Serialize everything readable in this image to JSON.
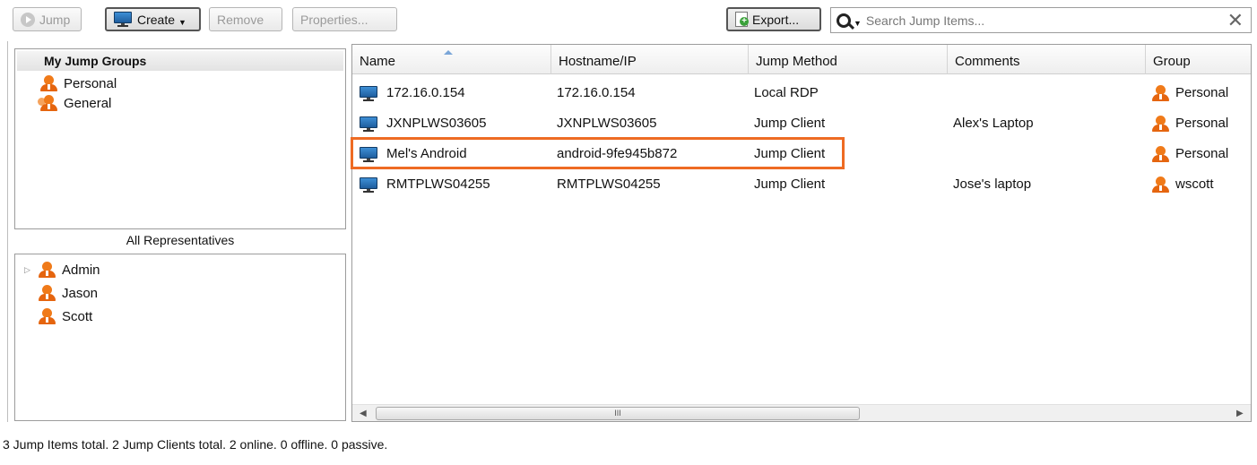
{
  "toolbar": {
    "jump_label": "Jump",
    "create_label": "Create",
    "remove_label": "Remove",
    "properties_label": "Properties...",
    "export_label": "Export...",
    "search_placeholder": "Search Jump Items...",
    "search_value": ""
  },
  "groups": {
    "header": "My Jump Groups",
    "items": [
      {
        "label": "Personal",
        "icon": "person-icon"
      },
      {
        "label": "General",
        "icon": "group-icon"
      }
    ]
  },
  "representatives": {
    "title": "All Representatives",
    "items": [
      {
        "label": "Admin",
        "expandable": true
      },
      {
        "label": "Jason",
        "expandable": false
      },
      {
        "label": "Scott",
        "expandable": false
      }
    ]
  },
  "table": {
    "columns": [
      "Name",
      "Hostname/IP",
      "Jump Method",
      "Comments",
      "Group"
    ],
    "rows": [
      {
        "name": "172.16.0.154",
        "host": "172.16.0.154",
        "method": "Local RDP",
        "comments": "",
        "group": "Personal"
      },
      {
        "name": "JXNPLWS03605",
        "host": "JXNPLWS03605",
        "method": "Jump Client",
        "comments": "Alex's Laptop",
        "group": "Personal"
      },
      {
        "name": "Mel's Android",
        "host": "android-9fe945b872",
        "method": "Jump Client",
        "comments": "",
        "group": "Personal"
      },
      {
        "name": "RMTPLWS04255",
        "host": "RMTPLWS04255",
        "method": "Jump Client",
        "comments": "Jose's laptop",
        "group": "wscott"
      }
    ],
    "scroll_thumb_label": "III"
  },
  "status": "3 Jump Items total.  2 Jump Clients total.  2 online.  0 offline.  0 passive.",
  "colors": {
    "highlight": "#ee6b23",
    "person": "#f07a19",
    "monitor": "#2b74bd"
  }
}
